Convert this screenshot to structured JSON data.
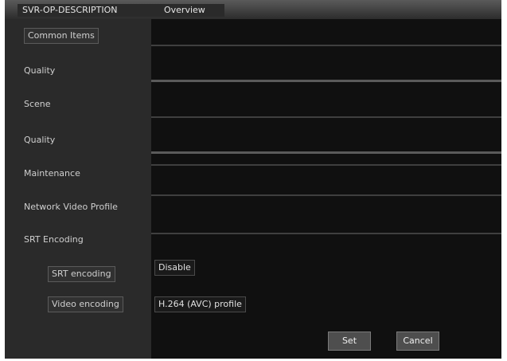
{
  "tabs": [
    {
      "label": "SVR-OP-DESCRIPTION"
    },
    {
      "label": "Overview"
    }
  ],
  "sections": [
    {
      "label": "Common Items"
    },
    {
      "label": "Quality"
    },
    {
      "label": "Scene"
    },
    {
      "label": "Quality"
    },
    {
      "label": "Maintenance"
    },
    {
      "label": "Network Video Profile"
    },
    {
      "label": "SRT Encoding"
    }
  ],
  "subfields": [
    {
      "label": "SRT encoding",
      "value": "Disable"
    },
    {
      "label": "Video encoding",
      "value": "H.264 (AVC) profile"
    }
  ],
  "buttons": {
    "set": "Set",
    "cancel": "Cancel"
  }
}
